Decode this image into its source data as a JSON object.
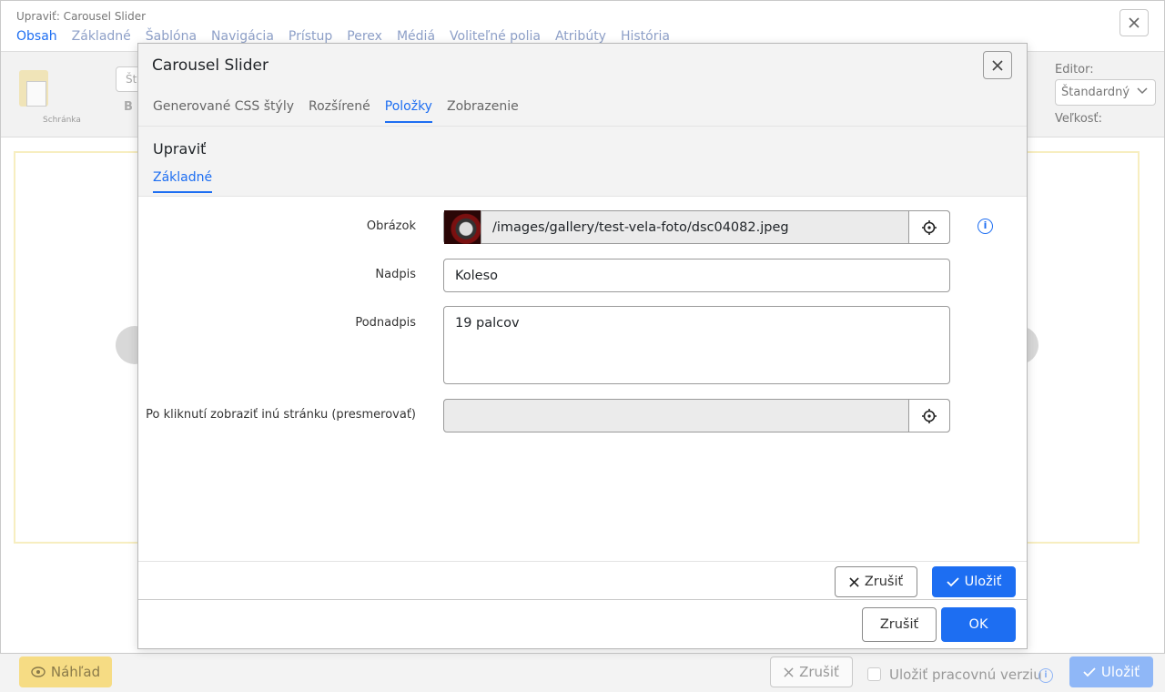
{
  "background": {
    "window_title": "Upraviť: Carousel Slider",
    "tabs": [
      {
        "label": "Obsah",
        "active": true
      },
      {
        "label": "Základné"
      },
      {
        "label": "Šablóna"
      },
      {
        "label": "Navigácia"
      },
      {
        "label": "Prístup"
      },
      {
        "label": "Perex"
      },
      {
        "label": "Médiá"
      },
      {
        "label": "Voliteľné polia"
      },
      {
        "label": "Atribúty"
      },
      {
        "label": "História"
      }
    ],
    "toolbar": {
      "clipboard_label": "Schránka",
      "style_placeholder": "Štý",
      "bold": "B",
      "editor_label": "Editor:",
      "editor_value": "Štandardný",
      "size_label": "Veľkosť:"
    },
    "footer": {
      "preview_label": "Náhľad",
      "cancel_label": "Zrušiť",
      "save_draft_label": "Uložiť pracovnú verziu",
      "save_label": "Uložiť"
    }
  },
  "modal": {
    "title": "Carousel Slider",
    "tabs": [
      {
        "label": "Generované CSS štýly"
      },
      {
        "label": "Rozšírené"
      },
      {
        "label": "Položky",
        "active": true
      },
      {
        "label": "Zobrazenie"
      }
    ],
    "subsection": {
      "title": "Upraviť",
      "tab": "Základné"
    },
    "form": {
      "image_label": "Obrázok",
      "image_value": "/images/gallery/test-vela-foto/dsc04082.jpeg",
      "heading_label": "Nadpis",
      "heading_value": "Koleso",
      "subheading_label": "Podnadpis",
      "subheading_value": "19 palcov",
      "redirect_label": "Po kliknutí zobraziť inú stránku (presmerovať)",
      "redirect_value": ""
    },
    "inner_footer": {
      "cancel_label": "Zrušiť",
      "save_label": "Uložiť"
    },
    "footer": {
      "cancel_label": "Zrušiť",
      "ok_label": "OK"
    }
  },
  "colors": {
    "accent": "#1d6ef2",
    "warning": "#f6dc84"
  }
}
